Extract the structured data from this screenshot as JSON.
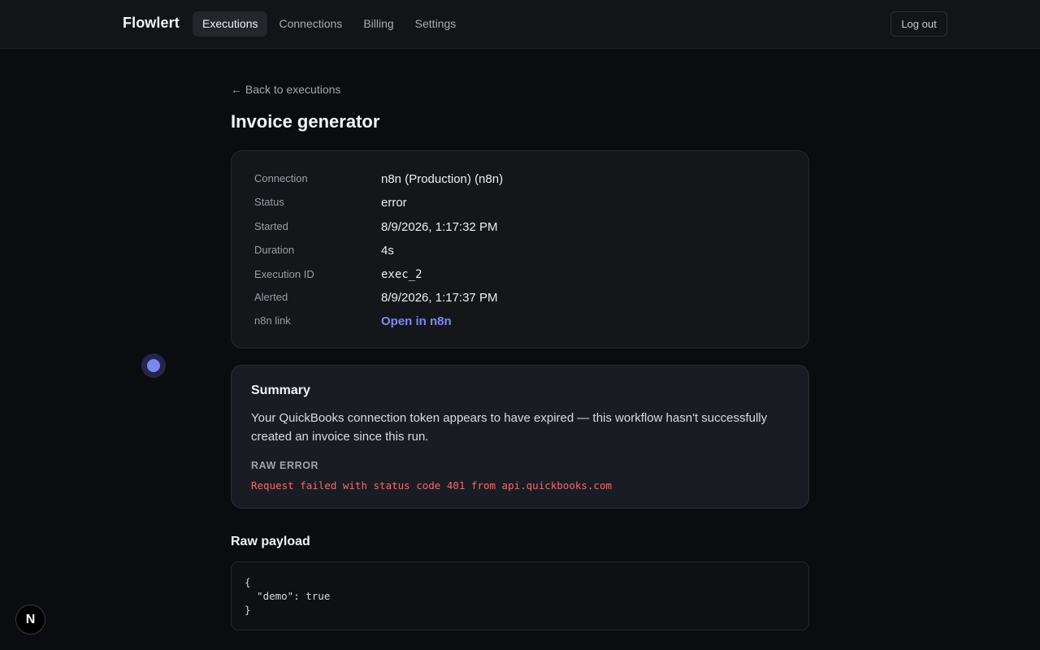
{
  "header": {
    "brand": "Flowlert",
    "nav": [
      {
        "label": "Executions",
        "active": true
      },
      {
        "label": "Connections",
        "active": false
      },
      {
        "label": "Billing",
        "active": false
      },
      {
        "label": "Settings",
        "active": false
      }
    ],
    "logout_label": "Log out"
  },
  "page": {
    "back_label": "← Back to executions",
    "title": "Invoice generator"
  },
  "details": {
    "connection_label": "Connection",
    "connection_value": "n8n (Production) (n8n)",
    "status_label": "Status",
    "status_value": "error",
    "started_label": "Started",
    "started_value": "8/9/2026, 1:17:32 PM",
    "duration_label": "Duration",
    "duration_value": "4s",
    "execution_id_label": "Execution ID",
    "execution_id_value": "exec_2",
    "alerted_label": "Alerted",
    "alerted_value": "8/9/2026, 1:17:37 PM",
    "link_label": "n8n link",
    "link_value": "Open in n8n"
  },
  "summary": {
    "title": "Summary",
    "text": "Your QuickBooks connection token appears to have expired — this workflow hasn't successfully created an invoice since this run.",
    "raw_error_label": "RAW ERROR",
    "raw_error_text": "Request failed with status code 401 from api.quickbooks.com"
  },
  "payload": {
    "title": "Raw payload",
    "code": "{\n  \"demo\": true\n}"
  },
  "badge": {
    "letter": "N"
  },
  "colors": {
    "accent": "#7f89f5",
    "error": "#f26a6a",
    "background": "#0b0c0f"
  }
}
